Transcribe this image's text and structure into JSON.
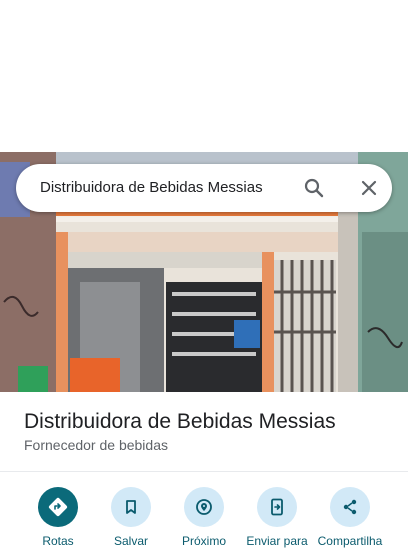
{
  "search": {
    "query": "Distribuidora de Bebidas Messias"
  },
  "place": {
    "name": "Distribuidora de Bebidas Messias",
    "category": "Fornecedor de bebidas"
  },
  "actions": [
    {
      "label": "Rotas",
      "icon": "directions-icon"
    },
    {
      "label": "Salvar",
      "icon": "bookmark-icon"
    },
    {
      "label": "Próximo",
      "icon": "nearby-icon"
    },
    {
      "label": "Enviar para",
      "icon": "send-to-phone-icon"
    },
    {
      "label": "Compartilha",
      "icon": "share-icon"
    }
  ],
  "colors": {
    "primary_action": "#0b6a7a",
    "action_bg": "#d2e9f7",
    "label": "#0b5b6d"
  }
}
